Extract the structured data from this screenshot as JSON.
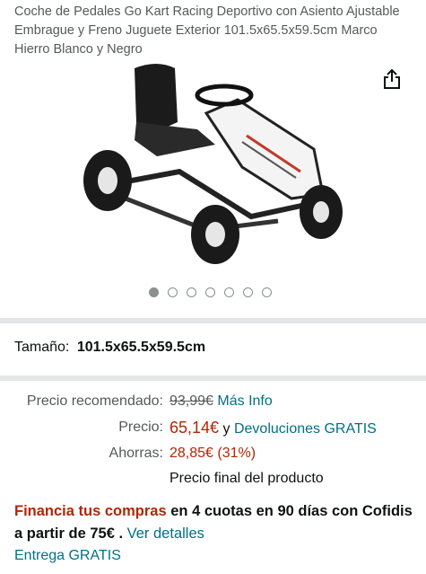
{
  "product": {
    "title": "Coche de Pedales Go Kart Racing Deportivo con Asiento Ajustable Embrague y Freno Juguete Exterior 101.5x65.5x59.5cm Marco Hierro Blanco y Negro"
  },
  "share_icon": "share-icon",
  "carousel": {
    "total_images": 7,
    "active_index": 0
  },
  "size": {
    "label": "Tamaño:",
    "value": "101.5x65.5x59.5cm"
  },
  "pricing": {
    "list_price_label": "Precio recomendado:",
    "list_price": "93,99€",
    "more_info": "Más Info",
    "price_label": "Precio:",
    "price": "65,14€",
    "and": "y",
    "returns": "Devoluciones GRATIS",
    "savings_label": "Ahorras:",
    "savings": "28,85€ (31%)",
    "final_price_note": "Precio final del producto"
  },
  "financing": {
    "highlight": "Financia tus compras",
    "text": "en 4 cuotas en 90 días con Cofidis a partir de 75€ .",
    "link": "Ver detalles"
  },
  "delivery": {
    "text": "Entrega GRATIS"
  },
  "colors": {
    "price": "#b12704",
    "link": "#007185",
    "secondary_text": "#565959"
  }
}
